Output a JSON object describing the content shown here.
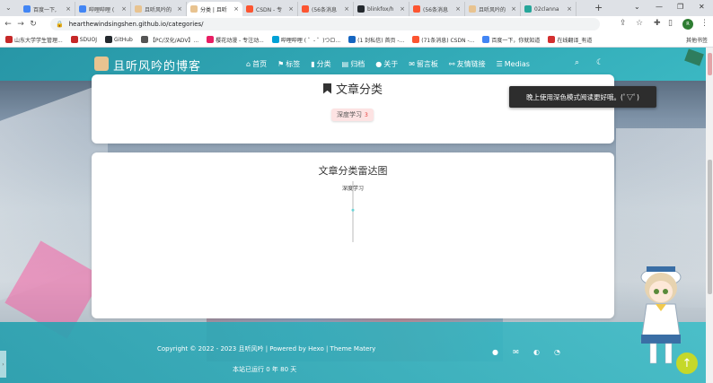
{
  "browser": {
    "tabs": [
      {
        "title": "百度一下,",
        "icon": "globe-icon",
        "color": "#4285f4"
      },
      {
        "title": "哔哩哔哩 (",
        "icon": "globe-icon",
        "color": "#4285f4"
      },
      {
        "title": "且听风吟的",
        "icon": "site-icon",
        "color": "#e8c390"
      },
      {
        "title": "分类 | 且听",
        "icon": "site-icon",
        "color": "#e8c390",
        "active": true
      },
      {
        "title": "CSDN - 专",
        "icon": "csdn-icon",
        "color": "#fc5531"
      },
      {
        "title": "(56条消息",
        "icon": "csdn-icon",
        "color": "#fc5531"
      },
      {
        "title": "blinkfox/h",
        "icon": "github-icon",
        "color": "#24292e"
      },
      {
        "title": "(56条消息",
        "icon": "csdn-icon",
        "color": "#fc5531"
      },
      {
        "title": "且听风吟的",
        "icon": "site-icon",
        "color": "#e8c390"
      },
      {
        "title": "02clanna",
        "icon": "globe-icon",
        "color": "#26a69a"
      }
    ],
    "new_tab": "+",
    "url": "hearthewindsingshen.github.io/categories/",
    "avatar_text": "R",
    "bookmarks": [
      {
        "label": "山东大学学生管理...",
        "color": "#c62828"
      },
      {
        "label": "SDUOJ",
        "color": "#c62828"
      },
      {
        "label": "GitHub",
        "color": "#24292e"
      },
      {
        "label": "【PC/汉化/ADV】...",
        "color": "#555"
      },
      {
        "label": "樱花动漫 - 专注动...",
        "color": "#e91e63"
      },
      {
        "label": "哔哩哔哩 ( ゜- ゜)つロ...",
        "color": "#00a1d6"
      },
      {
        "label": "(1 封私信) 首页 -...",
        "color": "#1565c0"
      },
      {
        "label": "(71条消息) CSDN -...",
        "color": "#fc5531"
      },
      {
        "label": "百度一下，你就知道",
        "color": "#4285f4"
      },
      {
        "label": "在线翻译_有道",
        "color": "#d32f2f"
      }
    ],
    "more_bookmarks": "其他书签"
  },
  "site": {
    "title": "且听风吟的博客",
    "menu": [
      {
        "label": "首页",
        "icon": "home-icon",
        "glyph": "⌂"
      },
      {
        "label": "标签",
        "icon": "tag-icon",
        "glyph": "⚑"
      },
      {
        "label": "分类",
        "icon": "bookmark-icon",
        "glyph": "▮"
      },
      {
        "label": "归档",
        "icon": "archive-icon",
        "glyph": "▤"
      },
      {
        "label": "关于",
        "icon": "user-icon",
        "glyph": "●"
      },
      {
        "label": "留言板",
        "icon": "comment-icon",
        "glyph": "✉"
      },
      {
        "label": "友情链接",
        "icon": "link-icon",
        "glyph": "⚯"
      },
      {
        "label": "Medias",
        "icon": "list-icon",
        "glyph": "☰"
      }
    ],
    "toast": "晚上使用深色模式阅读更好哦。(ﾟ▽ﾟ)"
  },
  "categories": {
    "heading": "文章分类",
    "items": [
      {
        "name": "深度学习",
        "count": "3"
      }
    ]
  },
  "radar": {
    "title": "文章分类雷达图",
    "indicator": "深度学习"
  },
  "chart_data": {
    "type": "radar",
    "title": "文章分类雷达图",
    "categories": [
      "深度学习"
    ],
    "values": [
      3
    ]
  },
  "footer": {
    "copyright": "Copyright © 2022 - 2023 且听风吟 | Powered by Hexo | Theme Matery",
    "uptime": "本站已运行 0 年 80 天"
  }
}
